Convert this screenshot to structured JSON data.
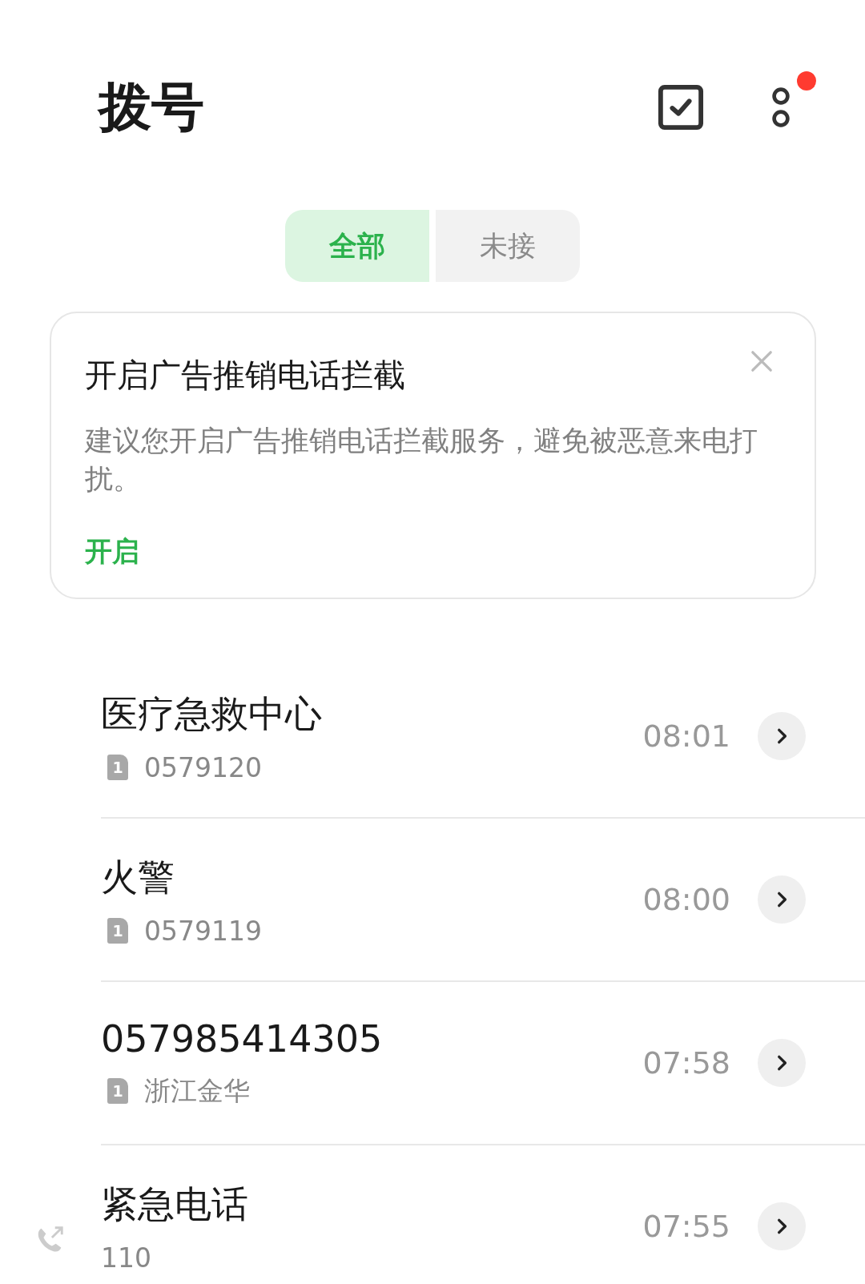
{
  "title": "拨号",
  "header": {
    "notification_dot": true
  },
  "tabs": [
    {
      "label": "全部",
      "selected": true
    },
    {
      "label": "未接",
      "selected": false
    }
  ],
  "banner": {
    "title": "开启广告推销电话拦截",
    "text": "建议您开启广告推销电话拦截服务，避免被恶意来电打扰。",
    "action": "开启"
  },
  "calls": [
    {
      "name": "医疗急救中心",
      "detail": "0579120",
      "sim": "1",
      "outgoing": false,
      "time": "08:01"
    },
    {
      "name": "火警",
      "detail": "0579119",
      "sim": "1",
      "outgoing": false,
      "time": "08:00"
    },
    {
      "name": "057985414305",
      "detail": "浙江金华",
      "sim": "1",
      "outgoing": false,
      "time": "07:58"
    },
    {
      "name": "紧急电话",
      "detail": "110",
      "outgoing": true,
      "time": "07:55"
    }
  ]
}
